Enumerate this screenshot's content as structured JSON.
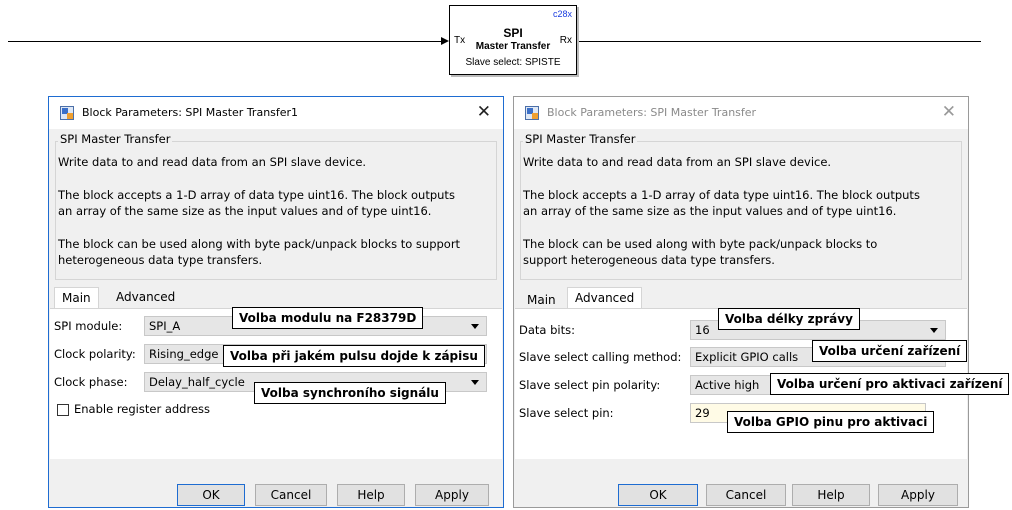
{
  "model": {
    "block": {
      "target": "c28x",
      "name": "SPI",
      "subtitle": "Master Transfer",
      "port_in": "Tx",
      "port_out": "Rx",
      "slave_select": "Slave select: SPISTE"
    }
  },
  "dialog_left": {
    "title": "Block Parameters: SPI Master Transfer1",
    "group_title": "SPI Master Transfer",
    "desc1": "Write data to and read data from an SPI slave device.",
    "desc2_line1": "The block accepts a 1-D array of data type uint16. The block outputs",
    "desc2_line2": "an array of the same size as the input values and of type uint16.",
    "desc3_line1": "The block can be used along with byte pack/unpack blocks to support",
    "desc3_line2": "heterogeneous data type transfers.",
    "tabs": [
      "Main",
      "Advanced"
    ],
    "params": [
      {
        "label": "SPI module:",
        "value": "SPI_A"
      },
      {
        "label": "Clock polarity:",
        "value": "Rising_edge"
      },
      {
        "label": "Clock phase:",
        "value": "Delay_half_cycle"
      }
    ],
    "checkbox_label": "Enable register address",
    "buttons": [
      "OK",
      "Cancel",
      "Help",
      "Apply"
    ]
  },
  "dialog_right": {
    "title": "Block Parameters: SPI Master Transfer",
    "group_title": "SPI Master Transfer",
    "desc1": "Write data to and read data from an SPI slave device.",
    "desc2_line1": "The block accepts a 1-D array of data type uint16. The block outputs",
    "desc2_line2": "an array of the same size as the input values and of type uint16.",
    "desc3_line1": "The block can be used along with byte pack/unpack blocks to",
    "desc3_line2": "support heterogeneous data type transfers.",
    "tabs": [
      "Main",
      "Advanced"
    ],
    "params": [
      {
        "label": "Data bits:",
        "value": "16"
      },
      {
        "label": "Slave select calling method:",
        "value": "Explicit GPIO calls"
      },
      {
        "label": "Slave select pin polarity:",
        "value": "Active high"
      },
      {
        "label": "Slave select pin:",
        "value": "29"
      }
    ],
    "buttons": [
      "OK",
      "Cancel",
      "Help",
      "Apply"
    ]
  },
  "callouts": {
    "module": "Volba modulu na F28379D",
    "polarity": "Volba při jakém pulsu dojde k zápisu",
    "phase": "Volba synchroního signálu",
    "data_bits": "Volba délky zprávy",
    "calling": "Volba určení  zařízení",
    "pin_polarity": "Volba určení pro aktivaci zařízení",
    "pin": "Volba GPIO pinu pro aktivaci"
  },
  "colors": {
    "accent_border": "#1e6cd1",
    "target_label": "#1a3de0",
    "field_bg": "#fffbe6"
  }
}
